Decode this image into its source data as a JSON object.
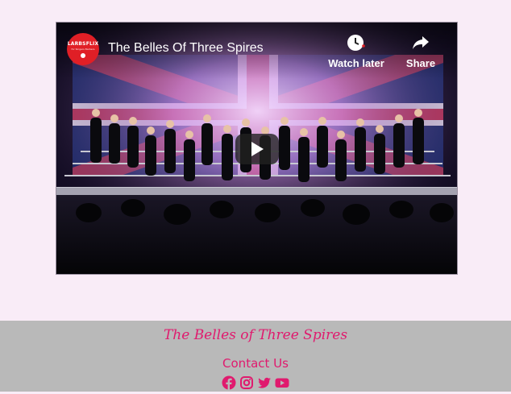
{
  "video": {
    "title": "The Belles Of Three Spires",
    "channel": {
      "name": "LARBSFLIX",
      "sub": "for Singers Barbers"
    },
    "watch_later_label": "Watch later",
    "share_label": "Share",
    "icons": {
      "watch_later": "clock-icon",
      "share": "share-arrow-icon",
      "play": "play-icon"
    }
  },
  "footer": {
    "brand": "The Belles of Three Spires",
    "contact_label": "Contact Us",
    "social": [
      "facebook-icon",
      "instagram-icon",
      "twitter-icon",
      "youtube-icon"
    ],
    "accent_color": "#e01a6e"
  },
  "colors": {
    "page_background": "#f9ecf7",
    "footer_background": "#b9b9b9",
    "channel_logo": "#e01f26"
  }
}
